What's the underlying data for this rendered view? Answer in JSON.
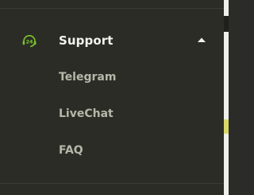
{
  "section": {
    "title": "Support",
    "icon": "support-24-headset-icon",
    "icon_text": "24",
    "expanded": true,
    "toggle_icon": "chevron-up-icon",
    "accent_color": "#7bc62d"
  },
  "submenu": {
    "items": [
      {
        "label": "Telegram"
      },
      {
        "label": "LiveChat"
      },
      {
        "label": "FAQ"
      }
    ]
  }
}
